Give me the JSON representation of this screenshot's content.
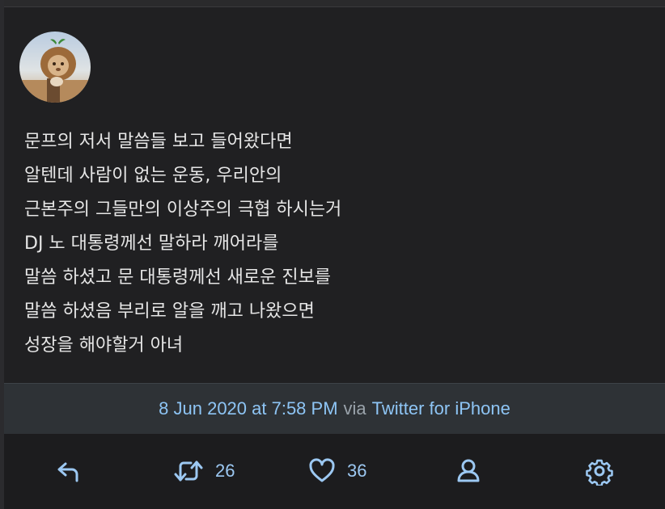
{
  "tweet": {
    "lines": [
      "문프의 저서 말씀들 보고 들어왔다면",
      "알텐데 사람이 없는 운동, 우리안의",
      "근본주의 그들만의 이상주의 극협 하시는거",
      "DJ 노 대통령께선 말하라 깨어라를",
      "말씀 하셨고 문 대통령께선 새로운 진보를",
      "말씀 하셨음 부리로 알을 깨고 나왔으면",
      "성장을 해야할거 아녀"
    ]
  },
  "meta": {
    "date": "8 Jun 2020 at 7:58 PM",
    "via": "via",
    "source": "Twitter for iPhone"
  },
  "actions": {
    "reply_icon": "reply-icon",
    "retweet_icon": "retweet-icon",
    "retweet_count": "26",
    "like_icon": "heart-icon",
    "like_count": "36",
    "profile_icon": "user-icon",
    "settings_icon": "gear-icon"
  },
  "colors": {
    "background": "#202022",
    "meta_bar": "#2e3236",
    "accent": "#8ec5f5",
    "text": "#e6e6e6"
  }
}
